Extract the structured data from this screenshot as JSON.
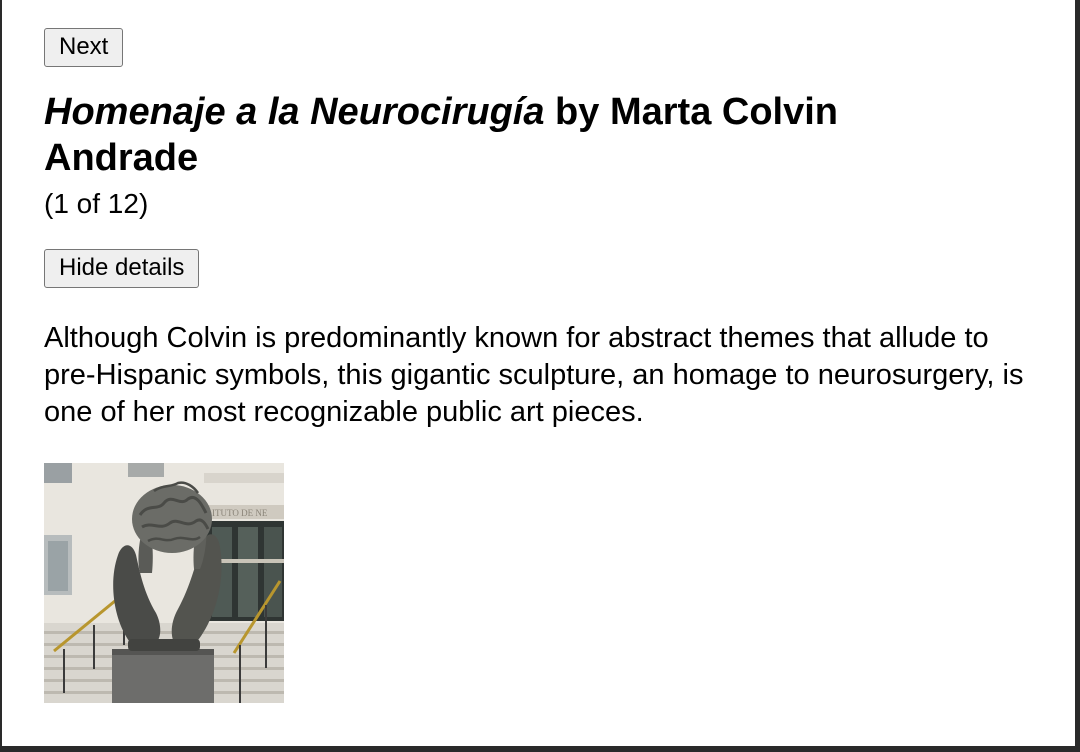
{
  "nav": {
    "next_label": "Next"
  },
  "artwork": {
    "title": "Homenaje a la Neurocirugía",
    "by_text": " by Marta Colvin Andrade",
    "counter": "(1 of 12)",
    "toggle_details_label": "Hide details",
    "description": "Although Colvin is predominantly known for abstract themes that allude to pre-Hispanic symbols, this gigantic sculpture, an homage to neurosurgery, is one of her most recognizable public art pieces.",
    "image_sign_text": "ITUTO DE NE"
  },
  "colors": {
    "page_background": "#ffffff",
    "window_border": "#2a2a2a",
    "button_background": "#efefef",
    "button_border": "#767676"
  }
}
